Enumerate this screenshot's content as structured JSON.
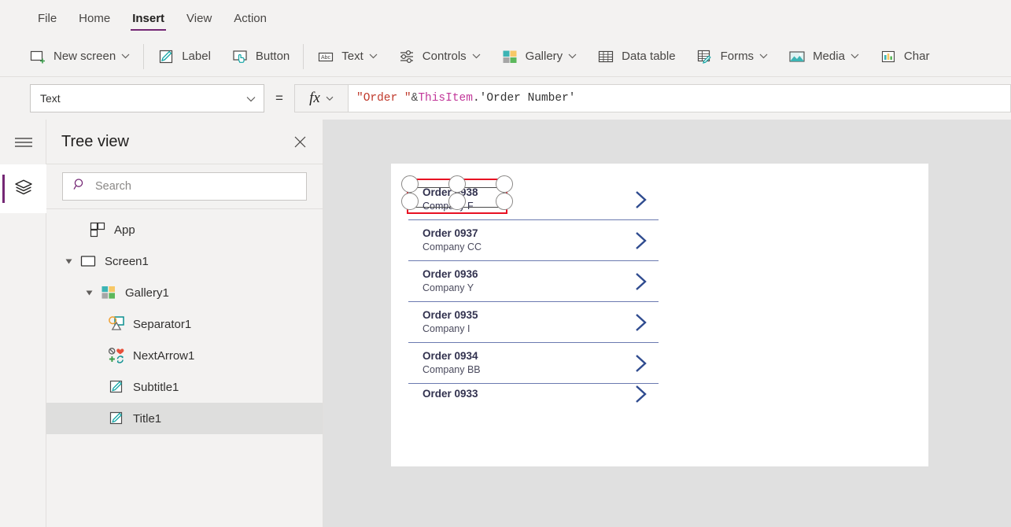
{
  "menubar": {
    "items": [
      {
        "label": "File",
        "active": false
      },
      {
        "label": "Home",
        "active": false
      },
      {
        "label": "Insert",
        "active": true
      },
      {
        "label": "View",
        "active": false
      },
      {
        "label": "Action",
        "active": false
      }
    ],
    "accent": "#742774"
  },
  "ribbon": {
    "items": [
      {
        "label": "New screen",
        "icon": "new-screen-icon",
        "caret": true
      },
      {
        "label": "Label",
        "icon": "label-icon",
        "caret": false
      },
      {
        "label": "Button",
        "icon": "button-icon",
        "caret": false
      },
      {
        "label": "Text",
        "icon": "text-icon",
        "caret": true
      },
      {
        "label": "Controls",
        "icon": "controls-icon",
        "caret": true
      },
      {
        "label": "Gallery",
        "icon": "gallery-icon",
        "caret": true
      },
      {
        "label": "Data table",
        "icon": "data-table-icon",
        "caret": false
      },
      {
        "label": "Forms",
        "icon": "forms-icon",
        "caret": true
      },
      {
        "label": "Media",
        "icon": "media-icon",
        "caret": true
      },
      {
        "label": "Char",
        "icon": "charts-icon",
        "caret": false
      }
    ]
  },
  "formula_bar": {
    "property": "Text",
    "equals": "=",
    "fx_label": "fx",
    "formula_tokens": [
      {
        "text": "\"Order \"",
        "kind": "string"
      },
      {
        "text": " & ",
        "kind": "operator"
      },
      {
        "text": "ThisItem",
        "kind": "identifier"
      },
      {
        "text": ".'Order Number'",
        "kind": "plain"
      }
    ],
    "formula_plain": "\"Order \" & ThisItem.'Order Number'",
    "colors": {
      "string": "#c0392b",
      "identifier": "#c2389a",
      "plain": "#333333"
    }
  },
  "rail": {
    "menu_icon": "hamburger-menu-icon",
    "buttons": [
      {
        "name": "tree-view-icon",
        "active": true
      }
    ]
  },
  "panel": {
    "title": "Tree view",
    "close_label": "✕",
    "search": {
      "placeholder": "Search",
      "value": ""
    },
    "tree": [
      {
        "label": "App",
        "icon": "app-icon",
        "indent": 0,
        "caret": "none",
        "selected": false
      },
      {
        "label": "Screen1",
        "icon": "screen-icon",
        "indent": 0,
        "caret": "expanded",
        "selected": false
      },
      {
        "label": "Gallery1",
        "icon": "gallery-icon",
        "indent": 1,
        "caret": "expanded",
        "selected": false
      },
      {
        "label": "Separator1",
        "icon": "shapes-icon",
        "indent": 2,
        "caret": "none",
        "selected": false
      },
      {
        "label": "NextArrow1",
        "icon": "icons-set-icon",
        "indent": 2,
        "caret": "none",
        "selected": false
      },
      {
        "label": "Subtitle1",
        "icon": "label-icon",
        "indent": 2,
        "caret": "none",
        "selected": false
      },
      {
        "label": "Title1",
        "icon": "label-icon",
        "indent": 2,
        "caret": "none",
        "selected": true
      }
    ]
  },
  "canvas": {
    "gallery": {
      "items": [
        {
          "title": "Order 0938",
          "subtitle": "Company F",
          "chevron": "chevron-right-icon",
          "selected": true
        },
        {
          "title": "Order 0937",
          "subtitle": "Company CC",
          "chevron": "chevron-right-icon",
          "selected": false
        },
        {
          "title": "Order 0936",
          "subtitle": "Company Y",
          "chevron": "chevron-right-icon",
          "selected": false
        },
        {
          "title": "Order 0935",
          "subtitle": "Company I",
          "chevron": "chevron-right-icon",
          "selected": false
        },
        {
          "title": "Order 0934",
          "subtitle": "Company BB",
          "chevron": "chevron-right-icon",
          "selected": false
        },
        {
          "title": "Order 0933",
          "subtitle": "",
          "chevron": "chevron-right-icon",
          "selected": false
        }
      ],
      "separator_color": "#6b7ab0",
      "chevron_color": "#2f4b8f",
      "title_color": "#32324f"
    },
    "selection": {
      "color": "#e81123",
      "handles": 8
    }
  }
}
